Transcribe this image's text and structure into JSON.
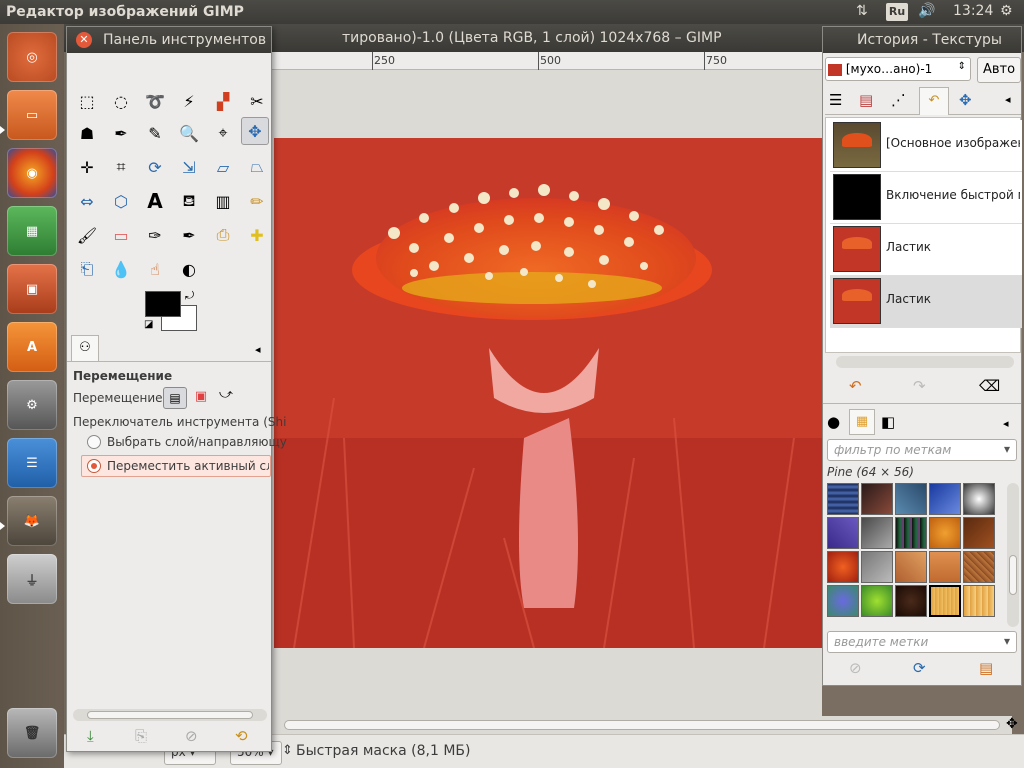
{
  "top_panel": {
    "app_title": "Редактор изображений GIMP",
    "keyboard_layout": "Ru",
    "clock": "13:24"
  },
  "main_window": {
    "title_visible": "тировано)-1.0 (Цвета RGB, 1 слой) 1024x768 – GIMP",
    "ruler_labels": [
      "250",
      "500",
      "750"
    ],
    "status": {
      "unit": "px",
      "zoom": "50%",
      "message": "Быстрая маска (8,1 МБ)"
    }
  },
  "toolbox": {
    "title": "Панель инструментов",
    "options": {
      "title": "Перемещение",
      "move_label": "Перемещение:",
      "switch_label": "Переключатель инструмента  (Shi",
      "radio_1": "Выбрать слой/направляющу",
      "radio_2": "Переместить активный слой"
    }
  },
  "dock": {
    "title": "История - Текстуры",
    "image_select": "[мухо…ано)-1",
    "auto_button": "Авто",
    "history": [
      {
        "label": "[Основное изображени"
      },
      {
        "label": "Включение быстрой ма"
      },
      {
        "label": "Ластик"
      },
      {
        "label": "Ластик"
      }
    ],
    "patterns": {
      "filter_placeholder": "фильтр по меткам",
      "pattern_name": "Pine (64 × 56)",
      "tags_placeholder": "введите метки"
    }
  },
  "colors": {
    "mask_red": "#c23628",
    "panel_dark": "#3c3b37",
    "panel_light": "#edecea",
    "close_orange": "#e3593a"
  }
}
